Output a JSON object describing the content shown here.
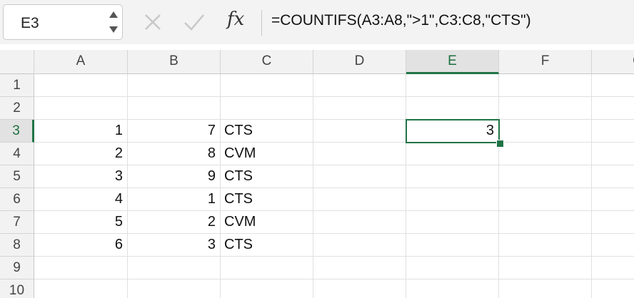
{
  "name_box": {
    "value": "E3"
  },
  "formula_bar": {
    "fx_label": "fx",
    "formula": "=COUNTIFS(A3:A8,\">1\",C3:C8,\"CTS\")"
  },
  "icons": {
    "cancel": "close-x-icon",
    "enter": "checkmark-icon",
    "stepper": "up-down-arrows-icon"
  },
  "colors": {
    "accent": "#217346",
    "header_bg": "#f2f2f2",
    "active_header_bg": "#e2e2e2"
  },
  "sheet": {
    "columns": [
      "A",
      "B",
      "C",
      "D",
      "E",
      "F",
      "G"
    ],
    "rows": [
      "1",
      "2",
      "3",
      "4",
      "5",
      "6",
      "7",
      "8",
      "9",
      "10"
    ],
    "active_cell": "E3",
    "cells": {
      "A3": "1",
      "B3": "7",
      "C3": "CTS",
      "E3": "3",
      "A4": "2",
      "B4": "8",
      "C4": "CVM",
      "A5": "3",
      "B5": "9",
      "C5": "CTS",
      "A6": "4",
      "B6": "1",
      "C6": "CTS",
      "A7": "5",
      "B7": "2",
      "C7": "CVM",
      "A8": "6",
      "B8": "3",
      "C8": "CTS"
    }
  }
}
